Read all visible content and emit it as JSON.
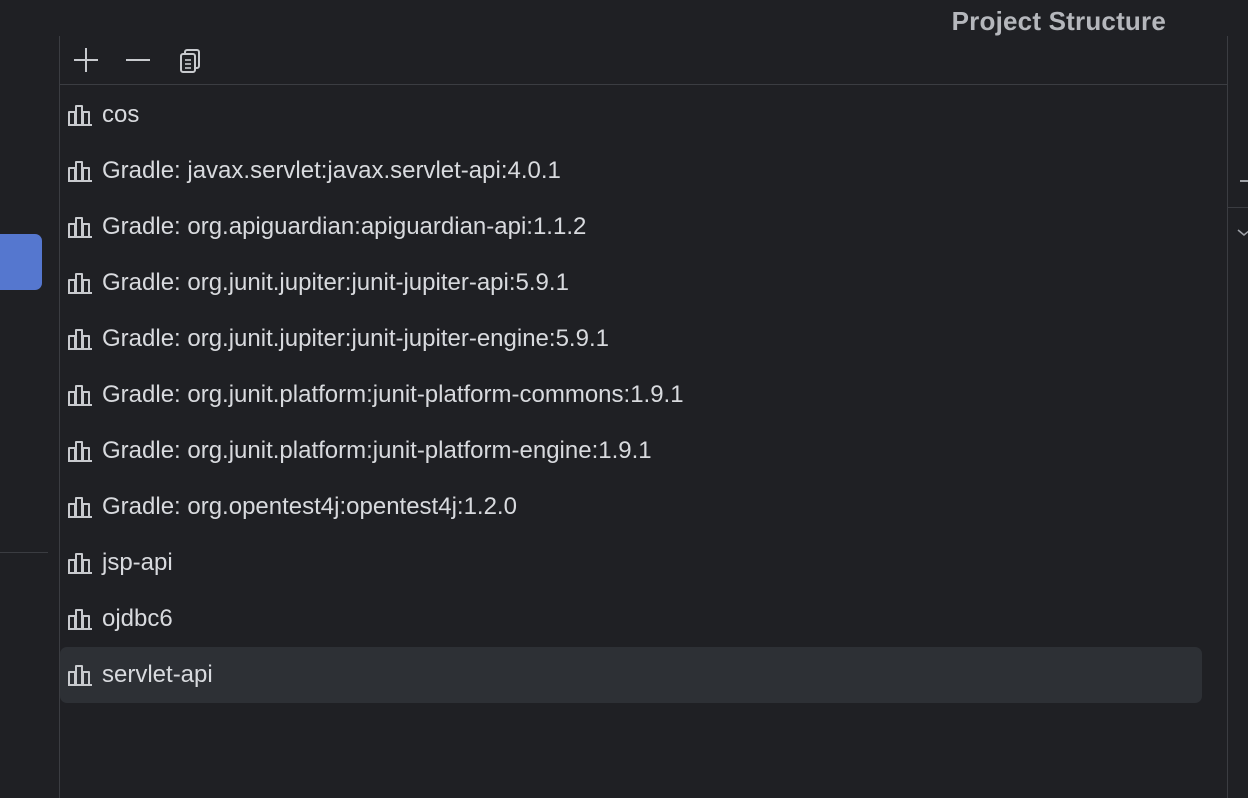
{
  "window": {
    "title": "Project Structure"
  },
  "toolbar": {
    "buttons": [
      {
        "name": "add-button",
        "icon": "plus-icon"
      },
      {
        "name": "remove-button",
        "icon": "minus-icon"
      },
      {
        "name": "copy-button",
        "icon": "copy-icon"
      }
    ]
  },
  "libraries": [
    {
      "label": "cos",
      "icon": "library-icon"
    },
    {
      "label": "Gradle: javax.servlet:javax.servlet-api:4.0.1",
      "icon": "library-icon"
    },
    {
      "label": "Gradle: org.apiguardian:apiguardian-api:1.1.2",
      "icon": "library-icon"
    },
    {
      "label": "Gradle: org.junit.jupiter:junit-jupiter-api:5.9.1",
      "icon": "library-icon"
    },
    {
      "label": "Gradle: org.junit.jupiter:junit-jupiter-engine:5.9.1",
      "icon": "library-icon"
    },
    {
      "label": "Gradle: org.junit.platform:junit-platform-commons:1.9.1",
      "icon": "library-icon"
    },
    {
      "label": "Gradle: org.junit.platform:junit-platform-engine:1.9.1",
      "icon": "library-icon"
    },
    {
      "label": "Gradle: org.opentest4j:opentest4j:1.2.0",
      "icon": "library-icon"
    },
    {
      "label": "jsp-api",
      "icon": "library-icon"
    },
    {
      "label": "ojdbc6",
      "icon": "library-icon"
    },
    {
      "label": "servlet-api",
      "icon": "library-icon",
      "selected": true
    }
  ],
  "colors": {
    "background": "#1f2024",
    "selected_row": "#2d3035",
    "accent": "#5577cf",
    "text": "#d8dade",
    "title": "#b5b7bc"
  }
}
